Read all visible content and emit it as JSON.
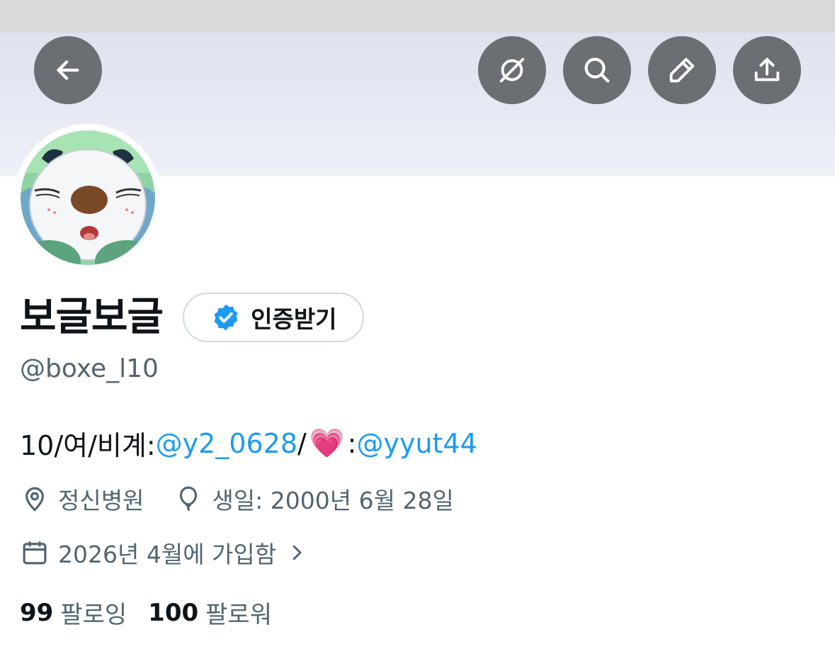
{
  "header": {
    "back_icon": "arrow-left-icon",
    "actions": [
      "grok-icon",
      "search-icon",
      "edit-pencil-icon",
      "share-upload-icon"
    ]
  },
  "profile": {
    "display_name": "보글보글",
    "verify_button_label": "인증받기",
    "handle": "@boxe_l10",
    "bio": {
      "prefix": "10/여/비계:",
      "mention1": "@y2_0628",
      "separator": "/",
      "emoji": "💗",
      "colon": ":",
      "mention2": "@yyut44"
    },
    "location": "정신병원",
    "birthday": "생일: 2000년 6월 28일",
    "joined": "2026년 4월에 가입함",
    "following_count": "99",
    "following_label": "팔로잉",
    "followers_count": "100",
    "followers_label": "팔로워"
  },
  "colors": {
    "accent": "#1d9bf0",
    "secondary_text": "#536471",
    "button_bg": "#6b6e73"
  }
}
